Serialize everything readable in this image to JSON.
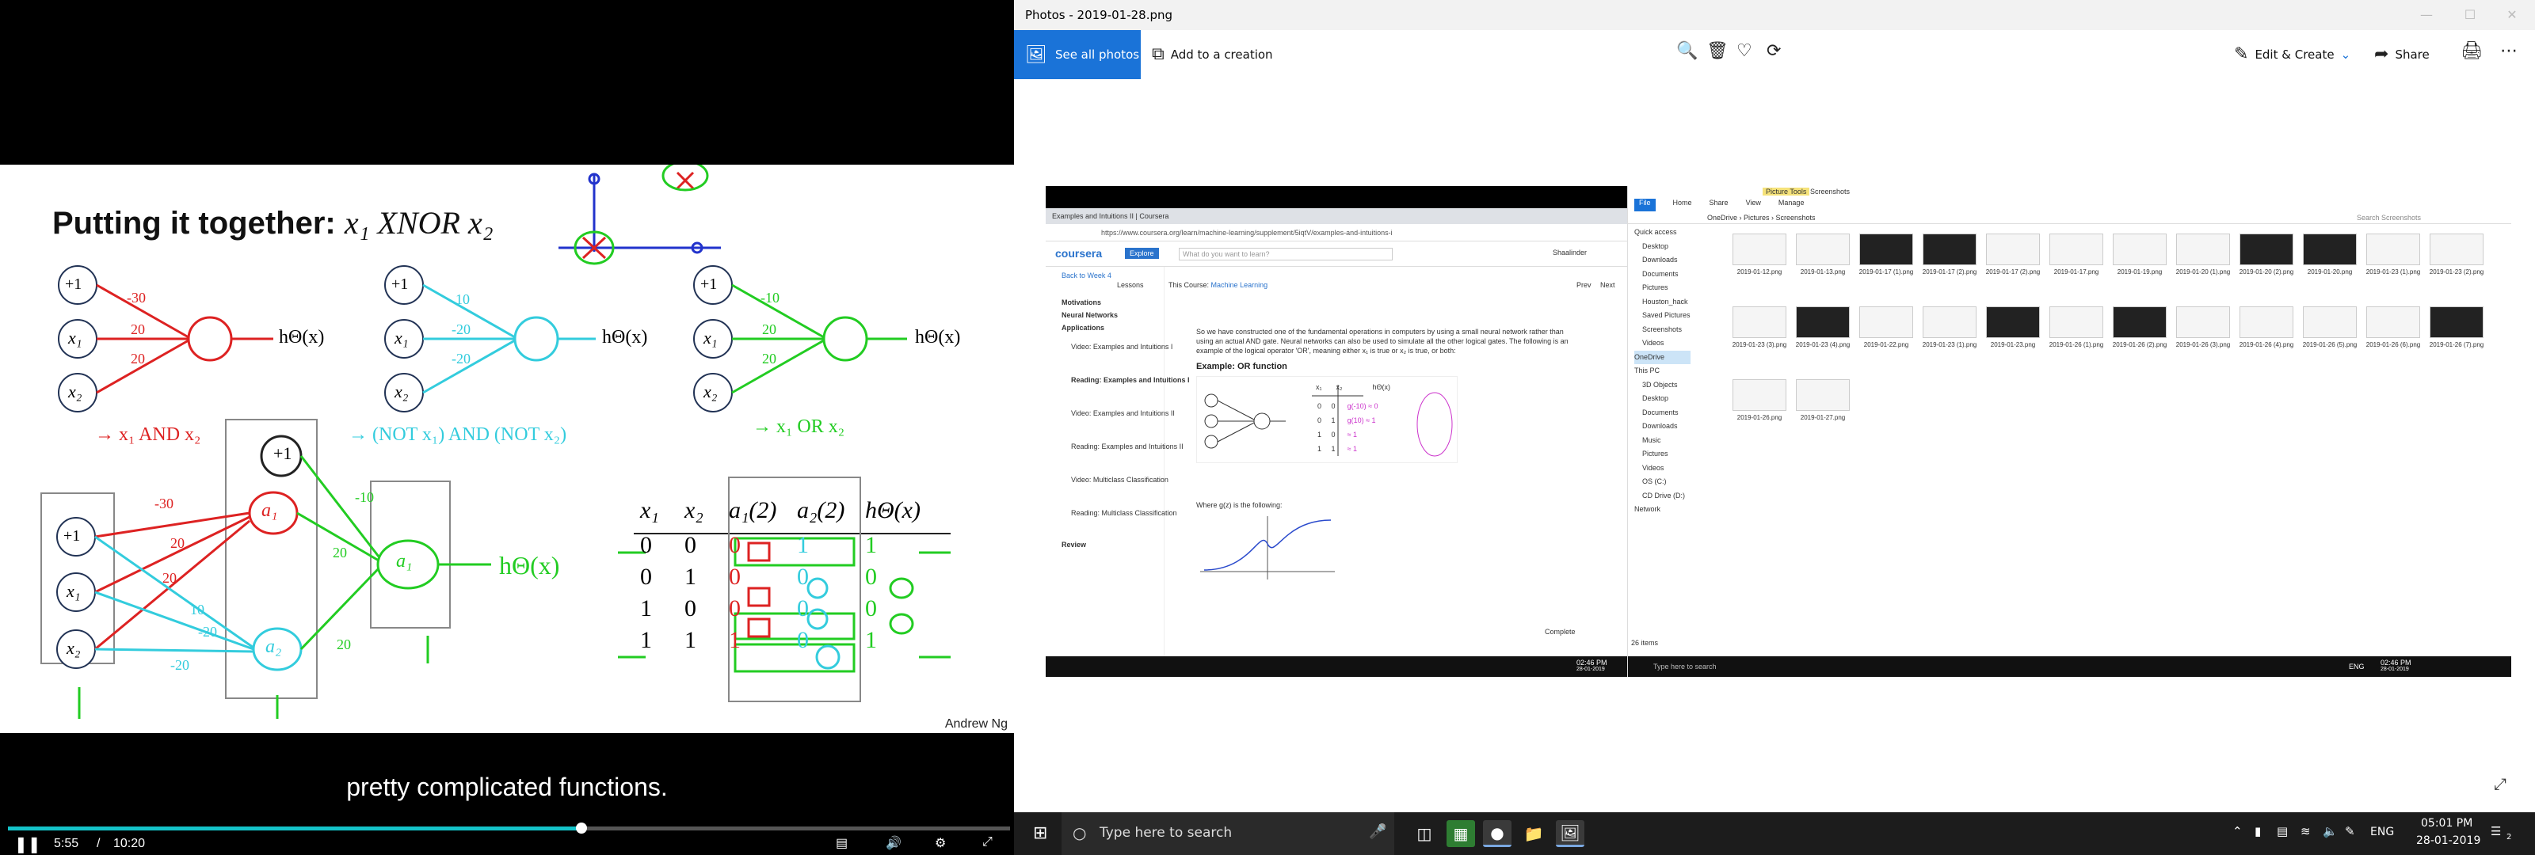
{
  "video": {
    "slide_title": "Putting it together:",
    "slide_title_math": "x₁ XNOR x₂",
    "credit": "Andrew Ng",
    "subtitle": "pretty complicated functions.",
    "time_current": "5:55",
    "time_separator": "/",
    "time_total": "10:20",
    "progress": 0.572,
    "net1": {
      "bias": "+1",
      "x1": "x₁",
      "x2": "x₂",
      "w0": "-30",
      "w1": "20",
      "w2": "20",
      "out": "hΘ(x)",
      "caption": "→ x₁ AND x₂"
    },
    "net2": {
      "bias": "+1",
      "x1": "x₁",
      "x2": "x₂",
      "w0": "10",
      "w1": "-20",
      "w2": "-20",
      "out": "hΘ(x)",
      "caption": "→ (NOT x₁) AND (NOT x₂)"
    },
    "net3": {
      "bias": "+1",
      "x1": "x₁",
      "x2": "x₂",
      "w0": "-10",
      "w1": "20",
      "w2": "20",
      "out": "hΘ(x)",
      "caption": "→ x₁ OR x₂"
    },
    "big_net": {
      "bias": "+1",
      "x1": "x₁",
      "x2": "x₂",
      "a1": "a₁",
      "a2": "a₂",
      "a3": "a₁",
      "out": "hΘ(x)",
      "w_a": "-30",
      "w_b": "20",
      "w_c": "20",
      "w_d": "10",
      "w_e": "-20",
      "w_f": "-20",
      "w_g": "-10",
      "w_h": "20",
      "w_i": "20"
    },
    "table": {
      "headers": [
        "x₁",
        "x₂",
        "a₁(2)",
        "a₂(2)",
        "hΘ(x)"
      ],
      "rows": [
        [
          "0",
          "0",
          "0",
          "1",
          "1"
        ],
        [
          "0",
          "1",
          "0",
          "0",
          "0"
        ],
        [
          "1",
          "0",
          "0",
          "0",
          "0"
        ],
        [
          "1",
          "1",
          "1",
          "0",
          "1"
        ]
      ]
    }
  },
  "photos": {
    "window_title": "Photos - 2019-01-28.png",
    "see_all": "See all photos",
    "add_creation": "Add to a creation",
    "edit_create": "Edit & Create",
    "share": "Share",
    "chrome": {
      "tab_title": "Examples and Intuitions II | Coursera",
      "url": "https://www.coursera.org/learn/machine-learning/supplement/5iqtV/examples-and-intuitions-i",
      "brand": "coursera",
      "explore": "Explore",
      "search_placeholder": "What do you want to learn?",
      "user": "Shaalinder",
      "back": "Back to Week 4",
      "lessons": "Lessons",
      "course_prefix": "This Course:",
      "course_name": "Machine Learning",
      "prev": "Prev",
      "next": "Next",
      "nav_items": [
        "Motivations",
        "Neural Networks",
        "Applications"
      ],
      "lesson_items": [
        "Video: Examples and Intuitions I",
        "Reading: Examples and Intuitions I",
        "Video: Examples and Intuitions II",
        "Reading: Examples and Intuitions II",
        "Video: Multiclass Classification",
        "Reading: Multiclass Classification"
      ],
      "review": "Review",
      "para": "So we have constructed one of the fundamental operations in computers by using a small neural network rather than using an actual AND gate. Neural networks can also be used to simulate all the other logical gates. The following is an example of the logical operator 'OR', meaning either x₁ is true or x₂ is true, or both:",
      "example_title": "Example: OR function",
      "or_headers": [
        "x₁",
        "x₂",
        "hΘ(x)"
      ],
      "or_rows": [
        [
          "0",
          "0",
          "g(-10) ≈ 0"
        ],
        [
          "0",
          "1",
          "g(10) ≈ 1"
        ],
        [
          "1",
          "0",
          "≈ 1"
        ],
        [
          "1",
          "1",
          "≈ 1"
        ]
      ],
      "sigmoid_caption": "Where g(z) is the following:",
      "complete": "Complete"
    },
    "explorer": {
      "tools_tab": "Picture Tools",
      "folder_title": "Screenshots",
      "ribbon": [
        "File",
        "Home",
        "Share",
        "View",
        "Manage"
      ],
      "path": [
        "OneDrive",
        "Pictures",
        "Screenshots"
      ],
      "search_placeholder": "Search Screenshots",
      "sidebar": [
        "Quick access",
        "Desktop",
        "Downloads",
        "Documents",
        "Pictures",
        "Houston_hack",
        "Saved Pictures",
        "Screenshots",
        "Videos",
        "OneDrive",
        "This PC",
        "3D Objects",
        "Desktop",
        "Documents",
        "Downloads",
        "Music",
        "Pictures",
        "Videos",
        "OS (C:)",
        "CD Drive (D:)",
        "Network"
      ],
      "files": [
        "2019-01-12.png",
        "2019-01-13.png",
        "2019-01-17 (1).png",
        "2019-01-17 (2).png",
        "2019-01-17 (2).png",
        "2019-01-17.png",
        "2019-01-19.png",
        "2019-01-20 (1).png",
        "2019-01-20 (2).png",
        "2019-01-20.png",
        "2019-01-23 (1).png",
        "2019-01-23 (2).png",
        "2019-01-23 (3).png",
        "2019-01-23 (4).png",
        "2019-01-22.png",
        "2019-01-23 (1).png",
        "2019-01-23.png",
        "2019-01-26 (1).png",
        "2019-01-26 (2).png",
        "2019-01-26 (3).png",
        "2019-01-26 (4).png",
        "2019-01-26 (5).png",
        "2019-01-26 (6).png",
        "2019-01-26 (7).png",
        "2019-01-26.png",
        "2019-01-27.png"
      ],
      "status": "26 items"
    },
    "inner_taskbar_search": "Type here to search",
    "inner_clock_time": "02:46 PM",
    "inner_clock_date": "28-01-2019",
    "inner_lang": "ENG"
  },
  "taskbar": {
    "search_placeholder": "Type here to search",
    "lang": "ENG",
    "time": "05:01 PM",
    "date": "28-01-2019",
    "notif_count": "2"
  }
}
